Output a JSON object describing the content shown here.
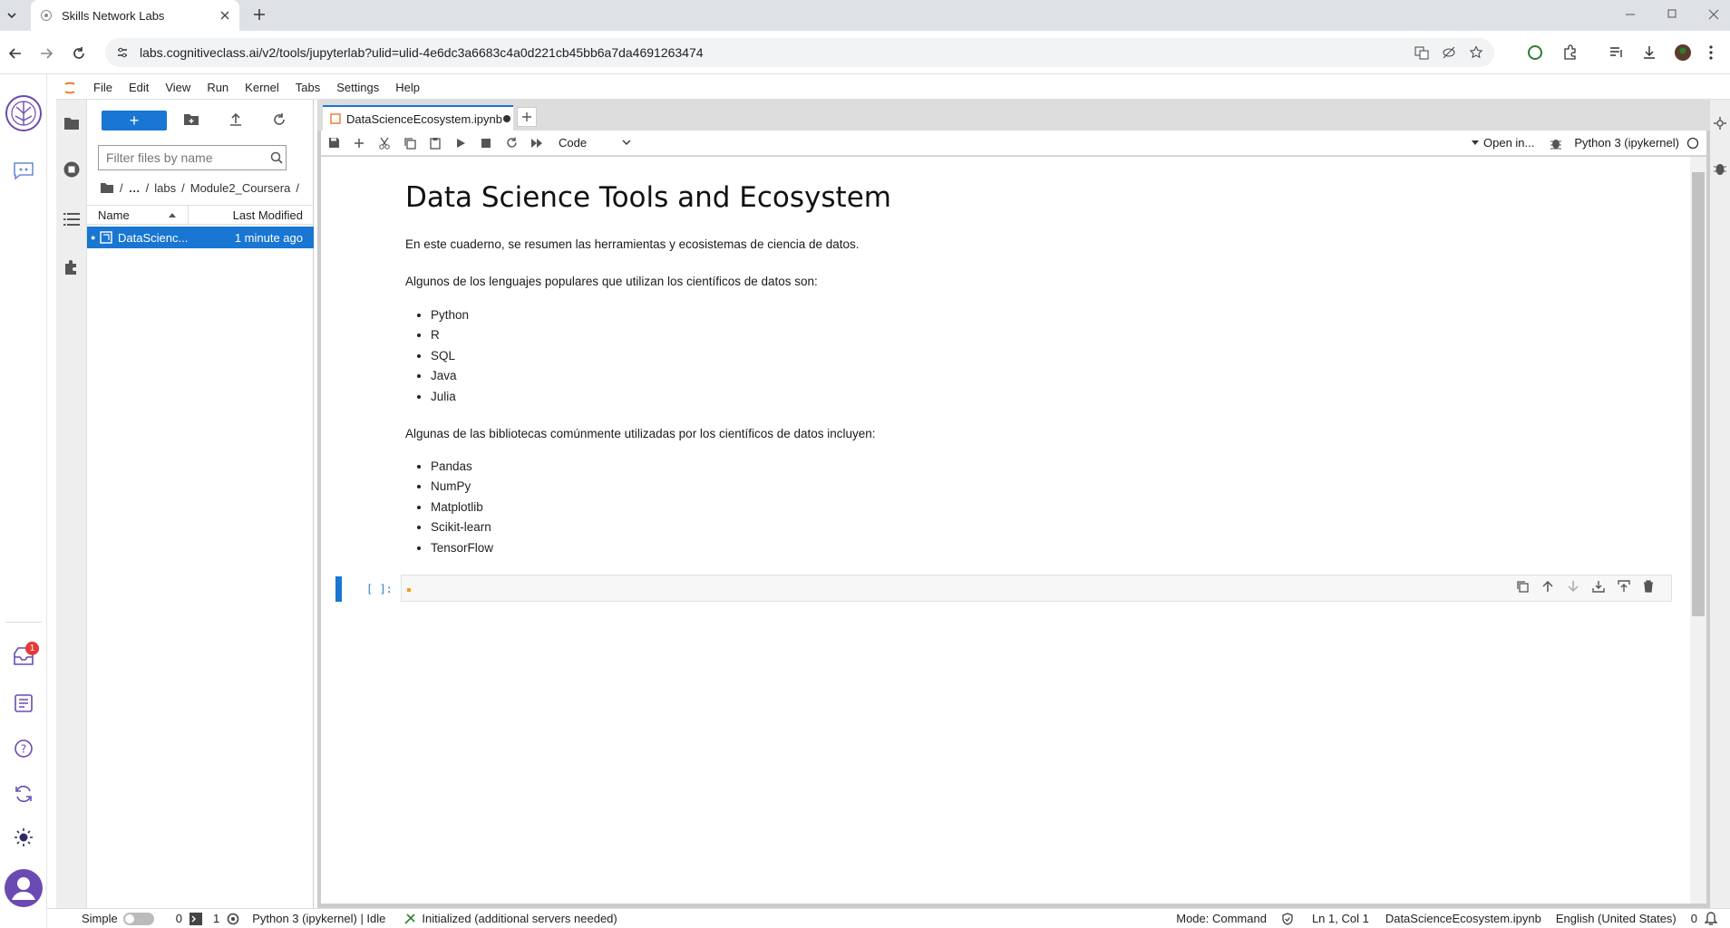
{
  "browser": {
    "tab_title": "Skills Network Labs",
    "url": "labs.cognitiveclass.ai/v2/tools/jupyterlab?ulid=ulid-4e6dc3a6683c4a0d221cb45bb6a7da4691263474"
  },
  "sn_bar": {
    "notification_count": "1"
  },
  "menubar": {
    "items": [
      "File",
      "Edit",
      "View",
      "Run",
      "Kernel",
      "Tabs",
      "Settings",
      "Help"
    ]
  },
  "filebrowser": {
    "new_label": "+",
    "filter_placeholder": "Filter files by name",
    "breadcrumb": {
      "ellipsis": "…",
      "labs": "labs",
      "folder": "Module2_Coursera",
      "sep": "/"
    },
    "columns": {
      "name": "Name",
      "modified": "Last Modified"
    },
    "rows": [
      {
        "name": "DataScienc...",
        "modified": "1 minute ago"
      }
    ]
  },
  "notebook": {
    "tab_label": "DataScienceEcosystem.ipynb",
    "cell_type": "Code",
    "open_in": "Open in...",
    "kernel": "Python 3 (ipykernel)",
    "heading": "Data Science Tools and Ecosystem",
    "intro": "En este cuaderno, se resumen las herramientas y ecosistemas de ciencia de datos.",
    "languages_intro": "Algunos de los lenguajes populares que utilizan los científicos de datos son:",
    "languages": [
      "Python",
      "R",
      "SQL",
      "Java",
      "Julia"
    ],
    "libraries_intro": "Algunas de las bibliotecas comúnmente utilizadas por los científicos de datos incluyen:",
    "libraries": [
      "Pandas",
      "NumPy",
      "Matplotlib",
      "Scikit-learn",
      "TensorFlow"
    ],
    "prompt": "[ ]:"
  },
  "statusbar": {
    "mode_label": "Simple",
    "terminals": "0",
    "kernels": "1",
    "kernel_status": "Python 3 (ipykernel) | Idle",
    "init_status": "Initialized (additional servers needed)",
    "mode": "Mode: Command",
    "position": "Ln 1, Col 1",
    "filename": "DataScienceEcosystem.ipynb",
    "language": "English (United States)",
    "notif_count": "0"
  },
  "colors": {
    "accent": "#1976d2",
    "sn_purple": "#6b4ab3"
  }
}
